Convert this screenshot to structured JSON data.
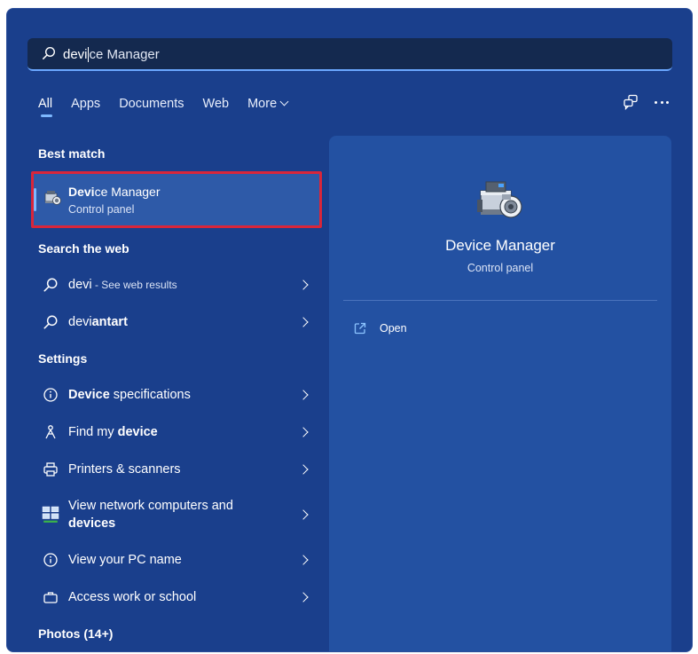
{
  "search": {
    "query_typed": "devi",
    "query_suggested": "ce Manager"
  },
  "tabs": [
    {
      "label": "All",
      "active": true
    },
    {
      "label": "Apps"
    },
    {
      "label": "Documents"
    },
    {
      "label": "Web"
    },
    {
      "label": "More"
    }
  ],
  "sections": {
    "best_match": "Best match",
    "search_web": "Search the web",
    "settings": "Settings",
    "photos": "Photos (14+)"
  },
  "best_match": {
    "title_bold": "Devi",
    "title_rest": "ce Manager",
    "subtitle": "Control panel",
    "icon": "device-manager-icon"
  },
  "web_results": [
    {
      "text": "devi",
      "hint": " - See web results",
      "icon": "search-icon"
    },
    {
      "bold": "devi",
      "rest": "antart",
      "icon": "search-icon"
    }
  ],
  "settings_items": [
    {
      "bold": "Device",
      "rest": " specifications",
      "icon": "info-icon"
    },
    {
      "pre": "Find my ",
      "bold": "device",
      "icon": "find-device-icon"
    },
    {
      "text": "Printers & scanners",
      "icon": "printer-icon"
    },
    {
      "line1": "View network computers and",
      "line2_bold": "devices",
      "icon": "network-icon"
    },
    {
      "text": "View your PC name",
      "icon": "info-icon"
    },
    {
      "text": "Access work or school",
      "icon": "briefcase-icon"
    }
  ],
  "preview": {
    "title": "Device Manager",
    "subtitle": "Control panel",
    "actions": [
      {
        "label": "Open",
        "icon": "open-external-icon"
      }
    ]
  },
  "colors": {
    "background": "#1a3f8c",
    "preview_panel": "#2351a2",
    "accent": "#7db8ff",
    "highlight_border": "#d9263a"
  }
}
